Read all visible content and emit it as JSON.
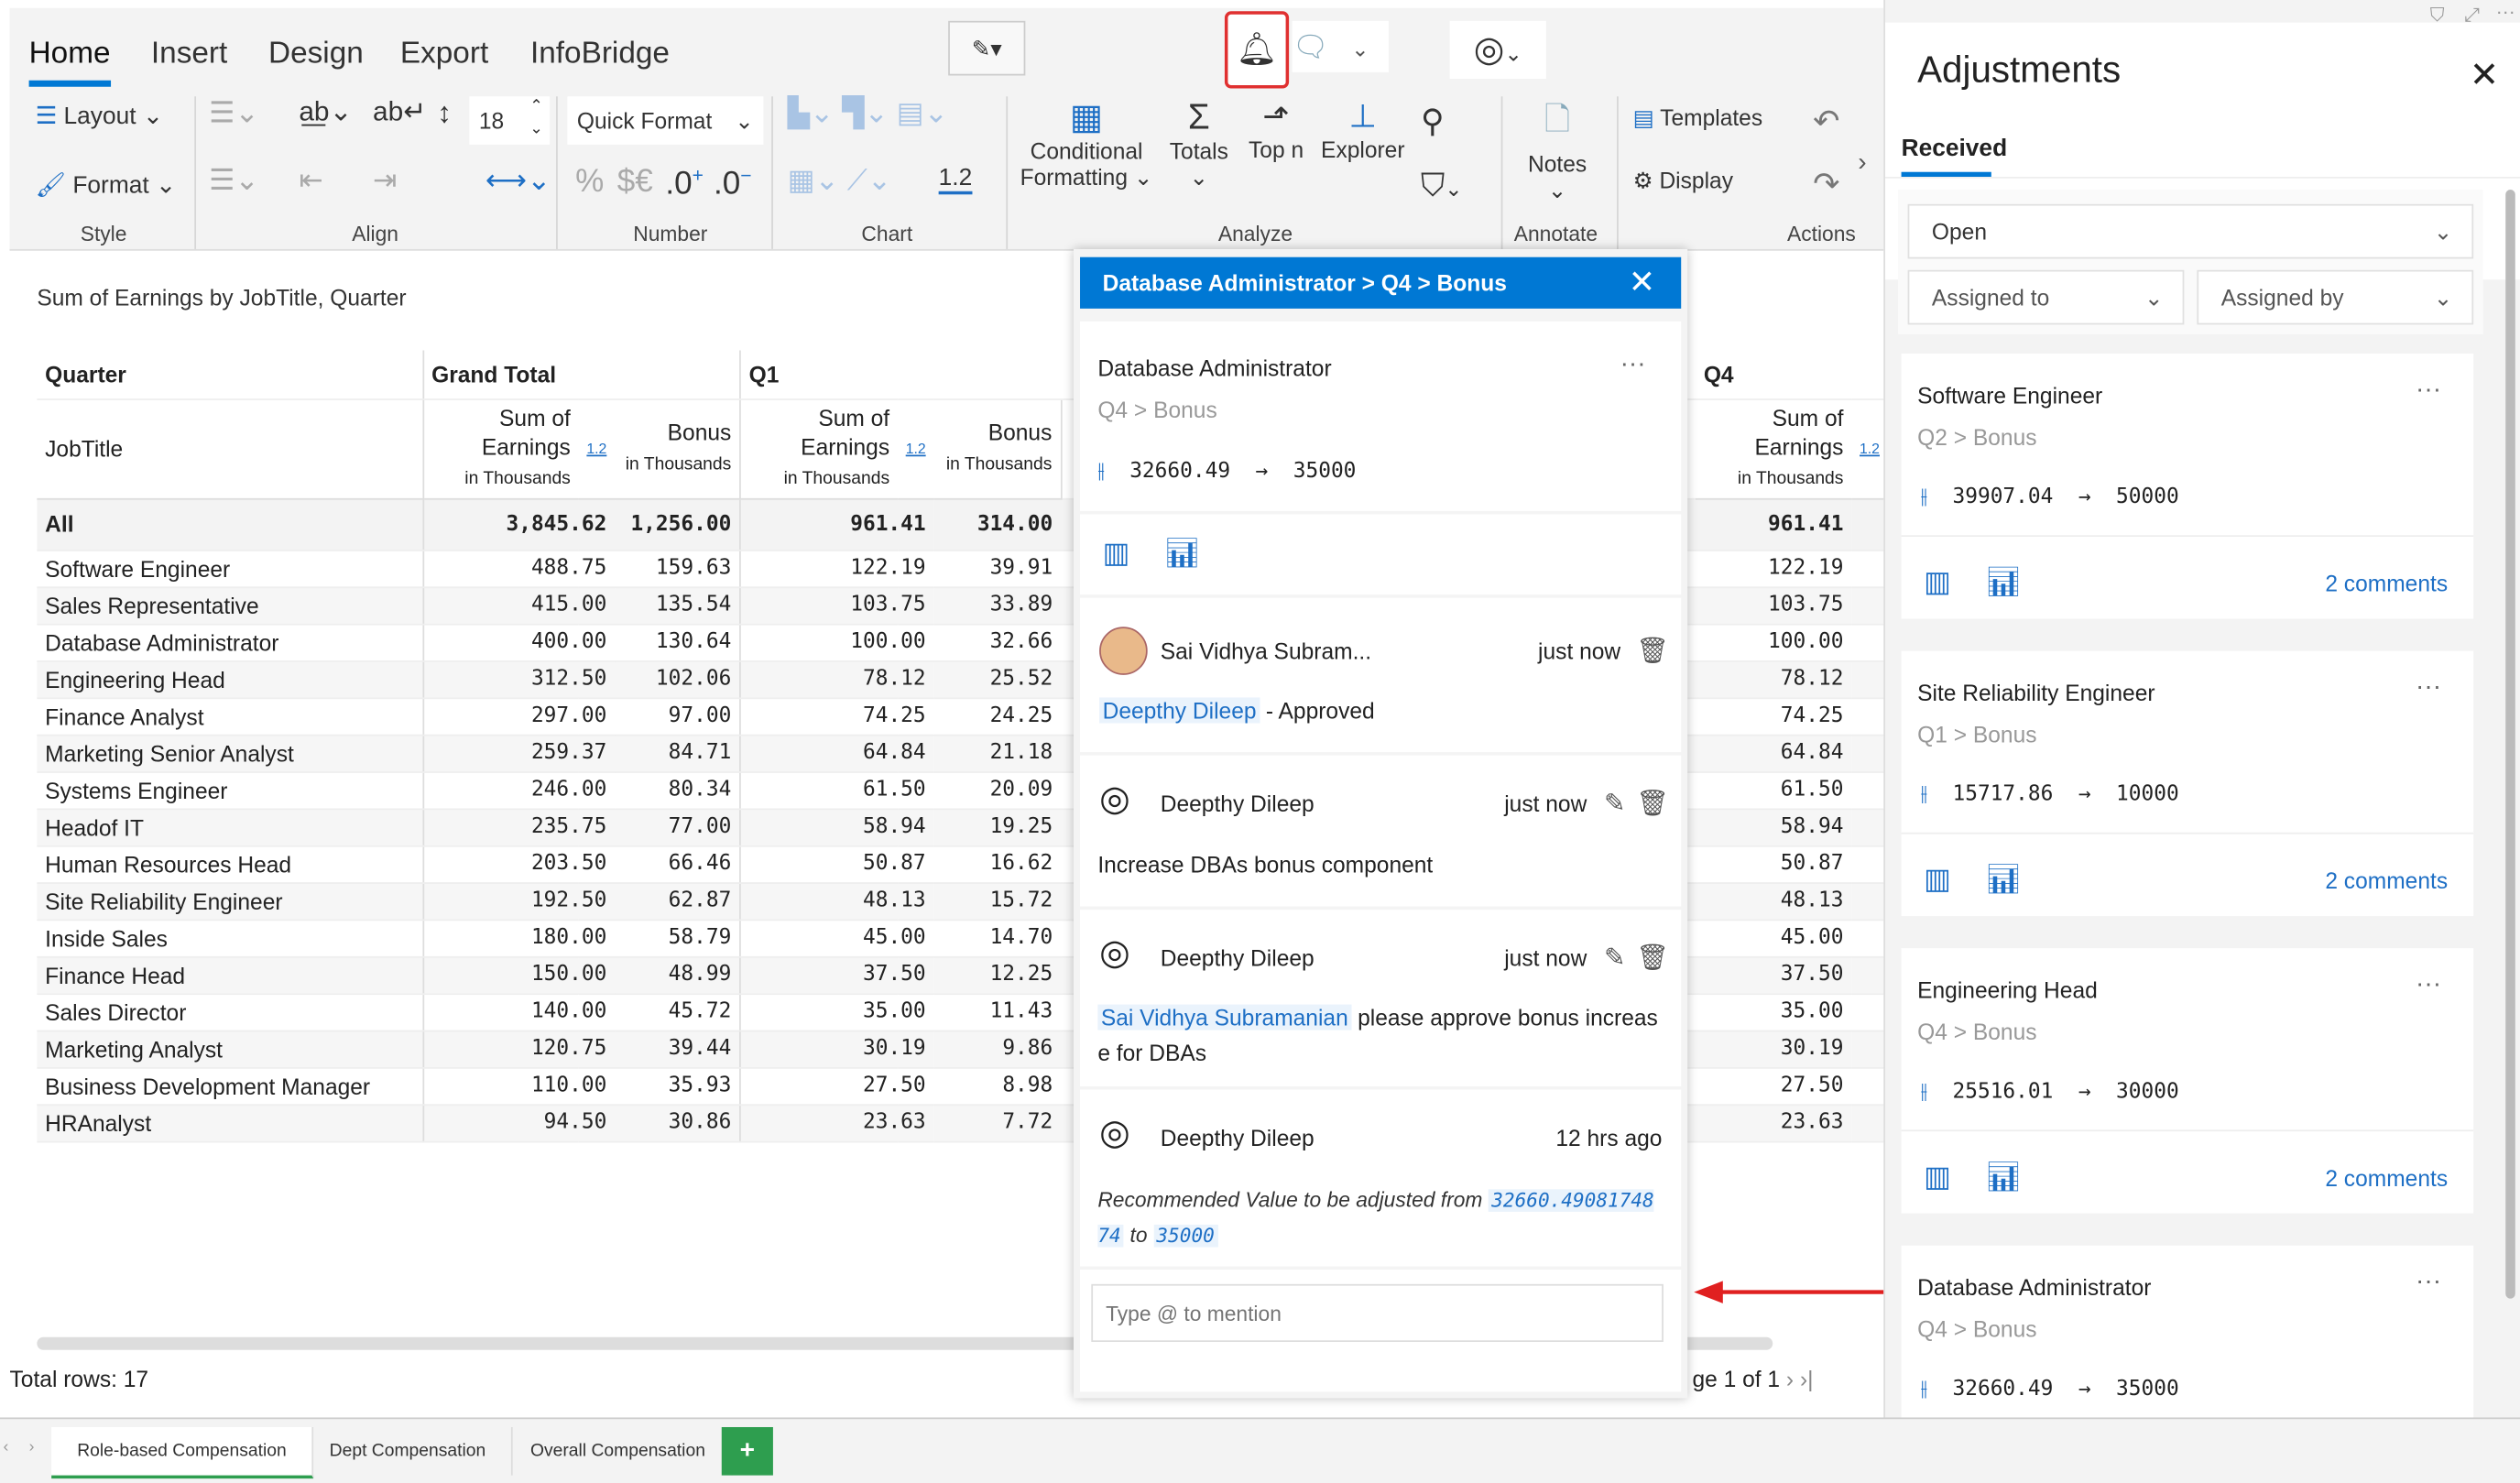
{
  "ribbon": {
    "tabs": [
      "Home",
      "Insert",
      "Design",
      "Export",
      "InfoBridge"
    ],
    "active_tab": "Home",
    "layout": "Layout",
    "format": "Format",
    "font_size": "18",
    "quick_format": "Quick Format",
    "decimal_label": "1.2",
    "percent": "%",
    "currency": "$€",
    "conditional": "Conditional",
    "formatting": "Formatting",
    "totals": "Totals",
    "topn": "Top n",
    "explorer": "Explorer",
    "notes": "Notes",
    "templates": "Templates",
    "display": "Display",
    "groups": [
      "Style",
      "Align",
      "Number",
      "Chart",
      "Analyze",
      "Annotate",
      "Actions"
    ]
  },
  "report": {
    "title": "Sum of Earnings by JobTitle, Quarter",
    "header": {
      "quarter": "Quarter",
      "grand_total": "Grand Total",
      "q1": "Q1",
      "q4": "Q4",
      "jobtitle": "JobTitle",
      "sum_of": "Sum of",
      "earnings": "Earnings",
      "in_thousands": "in Thousands",
      "bonus": "Bonus",
      "icon_label": "1.2"
    },
    "all": {
      "label": "All",
      "gt": "3,845.62",
      "gtb": "1,256.00",
      "q1": "961.41",
      "q1b": "314.00",
      "q4": "961.41"
    },
    "rows": [
      [
        "Software Engineer",
        "488.75",
        "159.63",
        "122.19",
        "39.91",
        "122.19"
      ],
      [
        "Sales Representative",
        "415.00",
        "135.54",
        "103.75",
        "33.89",
        "103.75"
      ],
      [
        "Database Administrator",
        "400.00",
        "130.64",
        "100.00",
        "32.66",
        "100.00"
      ],
      [
        "Engineering Head",
        "312.50",
        "102.06",
        "78.12",
        "25.52",
        "78.12"
      ],
      [
        "Finance Analyst",
        "297.00",
        "97.00",
        "74.25",
        "24.25",
        "74.25"
      ],
      [
        "Marketing Senior Analyst",
        "259.37",
        "84.71",
        "64.84",
        "21.18",
        "64.84"
      ],
      [
        "Systems Engineer",
        "246.00",
        "80.34",
        "61.50",
        "20.09",
        "61.50"
      ],
      [
        "Headof IT",
        "235.75",
        "77.00",
        "58.94",
        "19.25",
        "58.94"
      ],
      [
        "Human Resources Head",
        "203.50",
        "66.46",
        "50.87",
        "16.62",
        "50.87"
      ],
      [
        "Site Reliability Engineer",
        "192.50",
        "62.87",
        "48.13",
        "15.72",
        "48.13"
      ],
      [
        "Inside Sales",
        "180.00",
        "58.79",
        "45.00",
        "14.70",
        "45.00"
      ],
      [
        "Finance Head",
        "150.00",
        "48.99",
        "37.50",
        "12.25",
        "37.50"
      ],
      [
        "Sales Director",
        "140.00",
        "45.72",
        "35.00",
        "11.43",
        "35.00"
      ],
      [
        "Marketing Analyst",
        "120.75",
        "39.44",
        "30.19",
        "9.86",
        "30.19"
      ],
      [
        "Business Development Manager",
        "110.00",
        "35.93",
        "27.50",
        "8.98",
        "27.50"
      ],
      [
        "HRAnalyst",
        "94.50",
        "30.86",
        "23.63",
        "7.72",
        "23.63"
      ]
    ],
    "total_rows": "Total rows: 17",
    "pager": "ge 1 of 1"
  },
  "popup": {
    "title": "Database Administrator > Q4 > Bonus",
    "item": {
      "name": "Database Administrator",
      "path": "Q4 > Bonus",
      "from": "32660.49",
      "to": "35000"
    },
    "comments": [
      {
        "author": "Sai Vidhya Subram...",
        "time": "just now",
        "mention": "Deepthy Dileep",
        "text": " - Approved"
      },
      {
        "author": "Deepthy Dileep",
        "time": "just now",
        "text": "Increase DBAs bonus component"
      },
      {
        "author": "Deepthy Dileep",
        "time": "just now",
        "mention": "Sai Vidhya Subramanian",
        "text": " please approve bonus increas e for DBAs"
      },
      {
        "author": "Deepthy Dileep",
        "time": "12 hrs ago",
        "text_pre": "Recommended Value to be adjusted from ",
        "v1": "32660.49081748 74",
        "mid": " to ",
        "v2": "35000"
      }
    ],
    "input_placeholder": "Type @ to mention"
  },
  "panel": {
    "title": "Adjustments",
    "tab": "Received",
    "status": "Open",
    "assigned_to": "Assigned to",
    "assigned_by": "Assigned by",
    "cards": [
      {
        "name": "Software Engineer",
        "path": "Q2 > Bonus",
        "from": "39907.04",
        "to": "50000",
        "comments": "2 comments"
      },
      {
        "name": "Site Reliability Engineer",
        "path": "Q1 > Bonus",
        "from": "15717.86",
        "to": "10000",
        "comments": "2 comments"
      },
      {
        "name": "Engineering Head",
        "path": "Q4 > Bonus",
        "from": "25516.01",
        "to": "30000",
        "comments": "2 comments"
      },
      {
        "name": "Database Administrator",
        "path": "Q4 > Bonus",
        "from": "32660.49",
        "to": "35000",
        "comments": ""
      }
    ]
  },
  "sheets": {
    "tabs": [
      "Role-based Compensation",
      "Dept Compensation",
      "Overall Compensation"
    ],
    "active": "Role-based Compensation",
    "add": "+"
  },
  "colors": {
    "accent": "#0078d4",
    "highlight_border": "#e03030",
    "add_tab": "#2e9e4f",
    "arrow": "#e02020"
  }
}
